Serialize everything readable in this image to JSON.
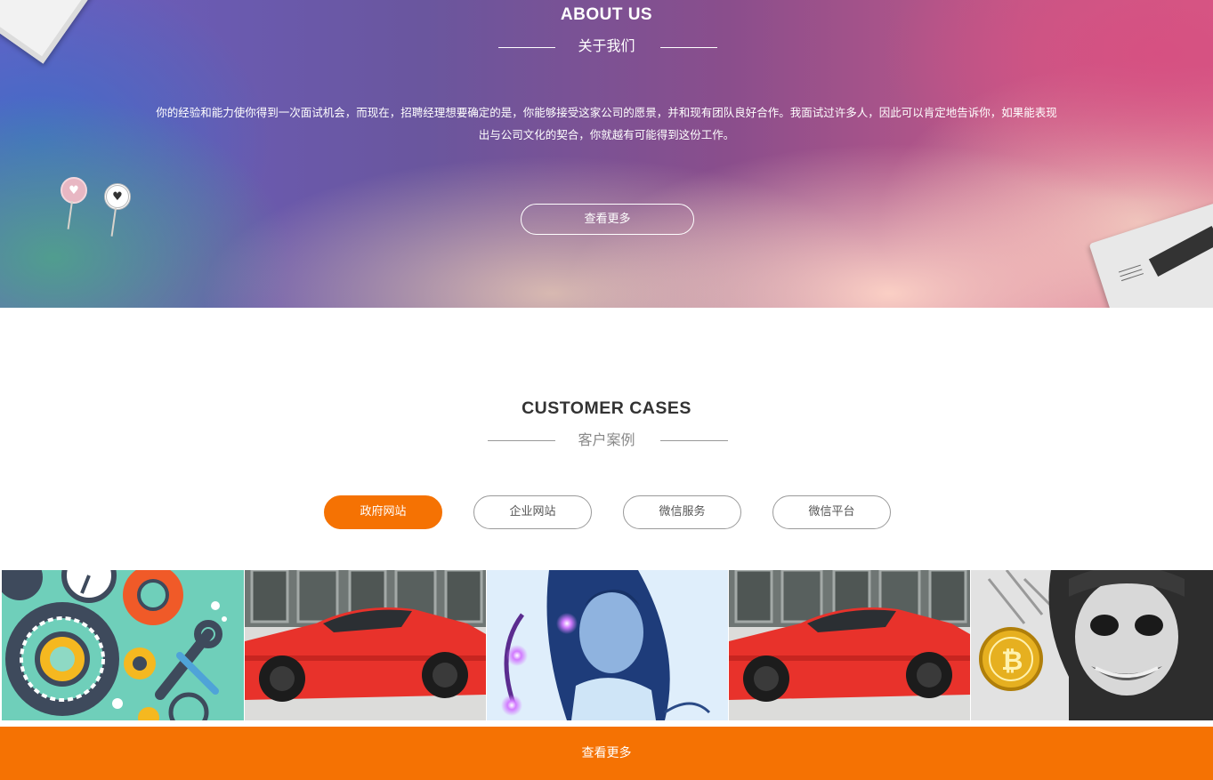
{
  "about": {
    "title": "ABOUT US",
    "subtitle": "关于我们",
    "description": "你的经验和能力使你得到一次面试机会，而现在，招聘经理想要确定的是，你能够接受这家公司的愿景，并和现有团队良好合作。我面试过许多人，因此可以肯定地告诉你，如果能表现出与公司文化的契合，你就越有可能得到这份工作。",
    "more_button": "查看更多"
  },
  "cases": {
    "title": "CUSTOMER CASES",
    "subtitle": "客户案例",
    "tabs": [
      {
        "label": "政府网站",
        "active": true
      },
      {
        "label": "企业网站",
        "active": false
      },
      {
        "label": "微信服务",
        "active": false
      },
      {
        "label": "微信平台",
        "active": false
      }
    ],
    "thumbnails": [
      "gears-illustration",
      "red-sports-car",
      "woman-with-glowing-cable",
      "red-sports-car",
      "joker-with-bitcoin"
    ]
  },
  "bottom": {
    "more_button": "查看更多"
  },
  "colors": {
    "accent": "#f57203"
  }
}
